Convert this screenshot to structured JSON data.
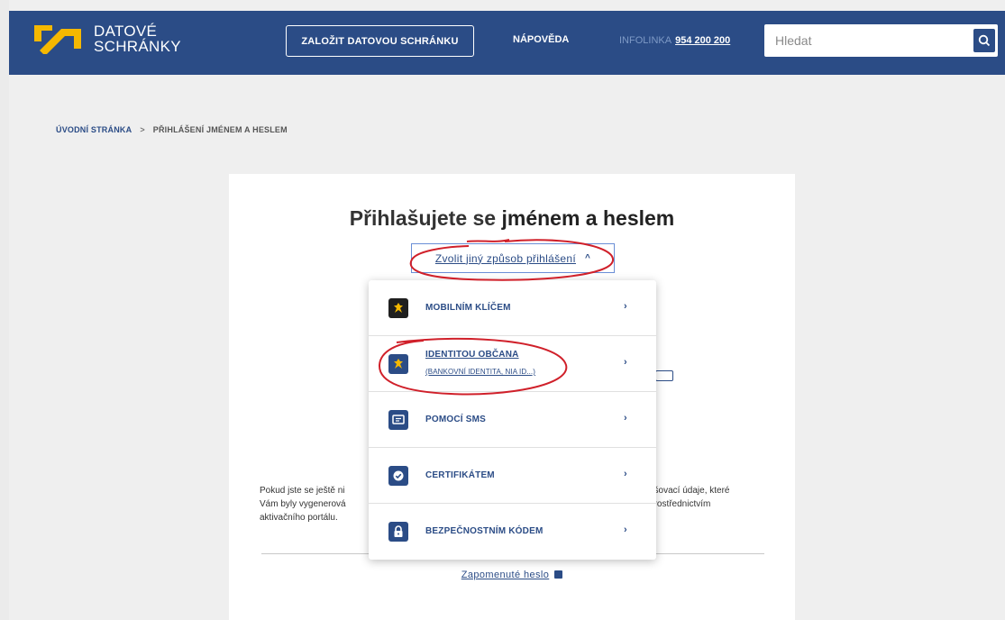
{
  "header": {
    "logo_line1": "DATOVÉ",
    "logo_line2": "SCHRÁNKY",
    "create_button": "ZALOŽIT DATOVOU SCHRÁNKU",
    "help_link": "NÁPOVĚDA",
    "infoline_label": "INFOLINKA",
    "infoline_number": "954 200 200",
    "search_placeholder": "Hledat"
  },
  "breadcrumb": {
    "home": "ÚVODNÍ STRÁNKA",
    "separator": ">",
    "current": "PŘIHLÁŠENÍ JMÉNEM A HESLEM"
  },
  "login": {
    "title_prefix": "Přihlašujete se ",
    "title_bold": "jménem a heslem",
    "switch_method": "Zvolit jiný způsob přihlášení",
    "switch_chevron": "^",
    "info_left_1": "Pokud jste se ještě ni",
    "info_left_2": "Vám byly vygenerová",
    "info_left_3": "aktivačního portálu.",
    "info_right_1": "ašovací údaje, které",
    "info_right_2": "prostřednictvím",
    "forgot_password": "Zapomenuté heslo"
  },
  "methods": [
    {
      "label": "MOBILNÍM KLÍČEM",
      "sub": "",
      "icon": "mobile-key-icon",
      "arrow": "›"
    },
    {
      "label": "IDENTITOU OBČANA",
      "sub": "(BANKOVNÍ IDENTITA, NIA ID...)",
      "icon": "citizen-identity-icon",
      "arrow": "›"
    },
    {
      "label": "POMOCÍ SMS",
      "sub": "",
      "icon": "sms-icon",
      "arrow": "›"
    },
    {
      "label": "CERTIFIKÁTEM",
      "sub": "",
      "icon": "certificate-icon",
      "arrow": "›"
    },
    {
      "label": "BEZPEČNOSTNÍM KÓDEM",
      "sub": "",
      "icon": "lock-icon",
      "arrow": "›"
    }
  ],
  "colors": {
    "header_bg": "#2b4c86",
    "logo_accent": "#f5b800",
    "annotation": "#d0202a"
  }
}
